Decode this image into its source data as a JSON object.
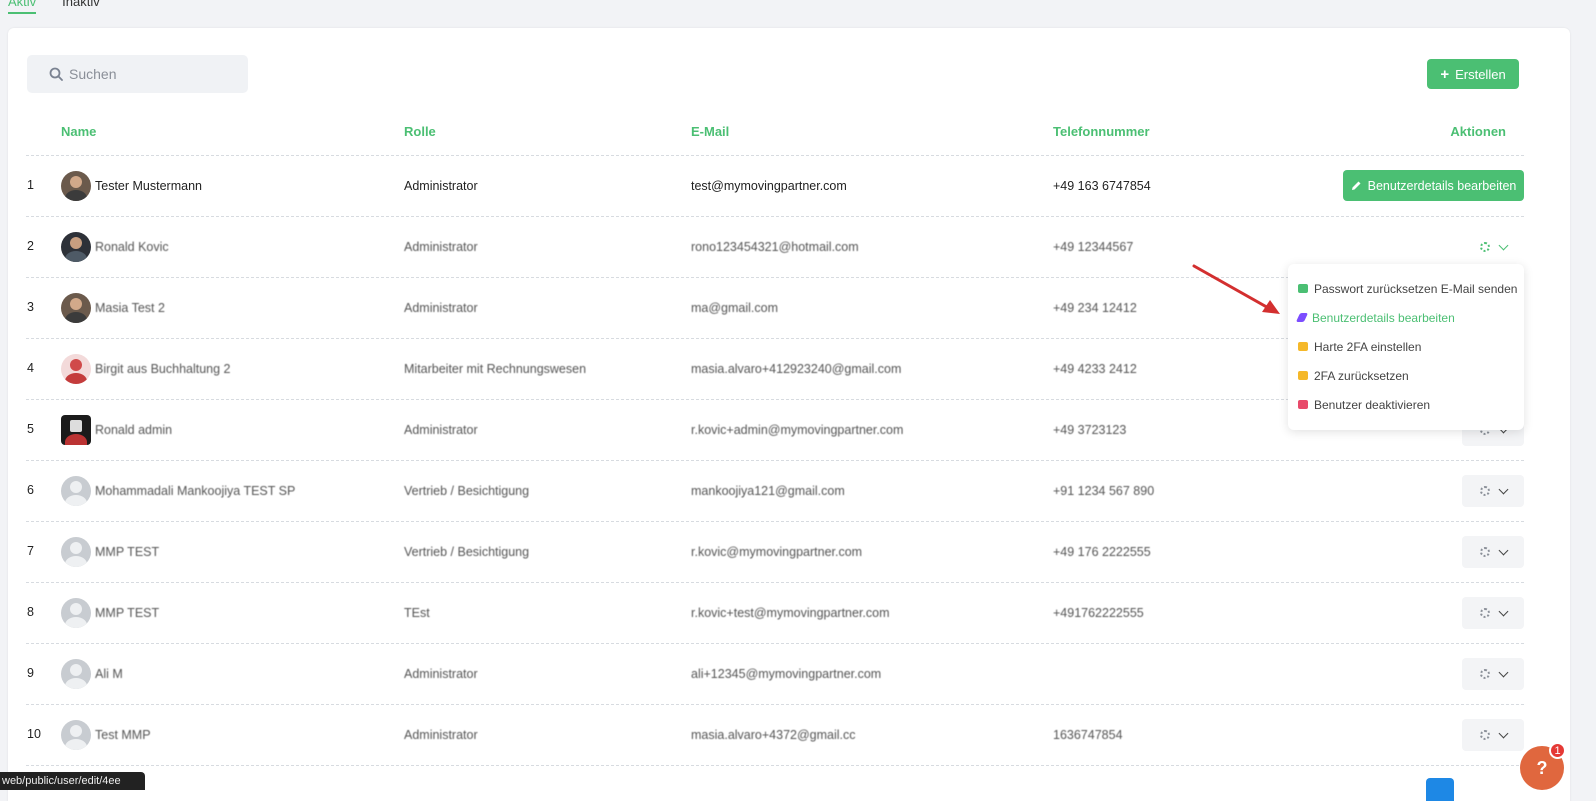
{
  "tabs": [
    {
      "label": "Aktiv"
    },
    {
      "label": "Inaktiv"
    }
  ],
  "search": {
    "placeholder": "Suchen"
  },
  "toolbar": {
    "create_label": "Erstellen"
  },
  "table": {
    "columns": [
      "Name",
      "Rolle",
      "E-Mail",
      "Telefonnummer",
      "Aktionen"
    ],
    "rows": [
      {
        "index": "1",
        "name": "Tester Mustermann",
        "role": "Administrator",
        "email": "test@mymovingpartner.com",
        "phone": "+49 163 6747854",
        "action_label": "Benutzerdetails bearbeiten"
      },
      {
        "index": "2",
        "name": "Ronald Kovic",
        "role": "Administrator",
        "email": "rono123454321@hotmail.com",
        "phone": "+49 12344567"
      },
      {
        "index": "3",
        "name": "Masia Test 2",
        "role": "Administrator",
        "email": "ma@gmail.com",
        "phone": "+49 234 12412"
      },
      {
        "index": "4",
        "name": "Birgit aus Buchhaltung 2",
        "role": "Mitarbeiter mit Rechnungswesen",
        "email": "masia.alvaro+412923240@gmail.com",
        "phone": "+49 4233 2412"
      },
      {
        "index": "5",
        "name": "Ronald admin",
        "role": "Administrator",
        "email": "r.kovic+admin@mymovingpartner.com",
        "phone": "+49 3723123"
      },
      {
        "index": "6",
        "name": "Mohammadali Mankoojiya TEST SP",
        "role": "Vertrieb / Besichtigung",
        "email": "mankoojiya121@gmail.com",
        "phone": "+91 1234 567 890"
      },
      {
        "index": "7",
        "name": "MMP TEST",
        "role": "Vertrieb / Besichtigung",
        "email": "r.kovic@mymovingpartner.com",
        "phone": "+49 176 2222555"
      },
      {
        "index": "8",
        "name": "MMP TEST",
        "role": "TEst",
        "email": "r.kovic+test@mymovingpartner.com",
        "phone": "+491762222555"
      },
      {
        "index": "9",
        "name": "Ali M",
        "role": "Administrator",
        "email": "ali+12345@mymovingpartner.com",
        "phone": ""
      },
      {
        "index": "10",
        "name": "Test MMP",
        "role": "Administrator",
        "email": "masia.alvaro+4372@gmail.cc",
        "phone": "1636747854"
      }
    ]
  },
  "dropdown": {
    "items": [
      {
        "label": "Passwort zurücksetzen E-Mail senden",
        "icon": "envelope-icon",
        "color": "#4bbf73"
      },
      {
        "label": "Benutzerdetails bearbeiten",
        "icon": "pencil-icon",
        "color": "#7c4dff"
      },
      {
        "label": "Harte 2FA einstellen",
        "icon": "lock-icon",
        "color": "#f5b829"
      },
      {
        "label": "2FA zurücksetzen",
        "icon": "lock-icon",
        "color": "#f5b829"
      },
      {
        "label": "Benutzer deaktivieren",
        "icon": "close-icon",
        "color": "#e84a6a"
      }
    ]
  },
  "statusbar": {
    "url": "web/public/user/edit/4ee"
  },
  "help": {
    "label": "?",
    "badge": "1"
  },
  "colors": {
    "accent": "#4bbf73",
    "help": "#e0673e",
    "arrow": "#d32f2f"
  }
}
